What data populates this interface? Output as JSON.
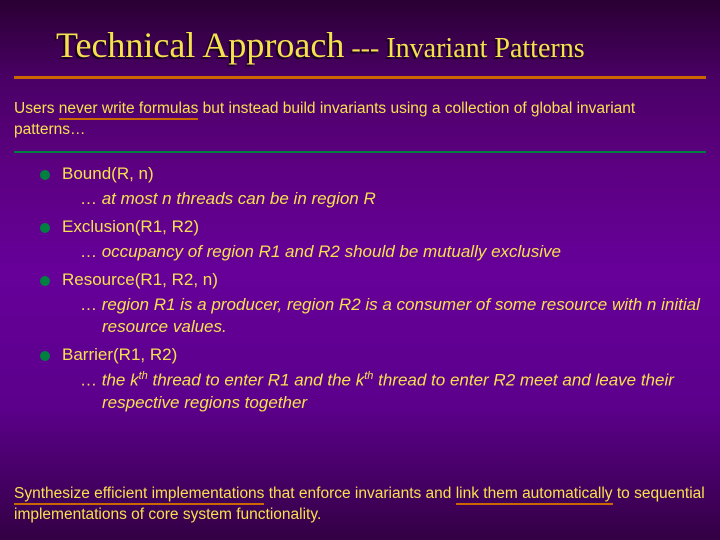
{
  "title": {
    "main": "Technical Approach",
    "sep": " --- ",
    "sub": "Invariant Patterns"
  },
  "intro": {
    "lead": "Users ",
    "underlined": "never write formulas",
    "rest": " but instead build invariants using a collection of global invariant patterns…"
  },
  "bullets": {
    "b0": {
      "name": "Bound(R, n)",
      "ell": "…",
      "desc": " at most n threads can be in region R"
    },
    "b1": {
      "name": "Exclusion(R1, R2)",
      "ell": "…",
      "desc": " occupancy of region R1 and R2 should be mutually exclusive"
    },
    "b2": {
      "name": "Resource(R1, R2, n)",
      "ell": "…",
      "desc": " region R1 is a producer, region R2 is a consumer of some resource with n initial resource values."
    },
    "b3": {
      "name": "Barrier(R1, R2)",
      "ell": "…",
      "desc_a": " the k",
      "sup": "th",
      "desc_b": " thread to enter R1 and the k",
      "desc_c": " thread to enter R2 meet and leave their respective regions together"
    }
  },
  "footer": {
    "u1": "Synthesize efficient implementations",
    "m1": " that enforce invariants and ",
    "u2": "link them automatically",
    "m2": " to sequential implementations of core system functionality."
  }
}
